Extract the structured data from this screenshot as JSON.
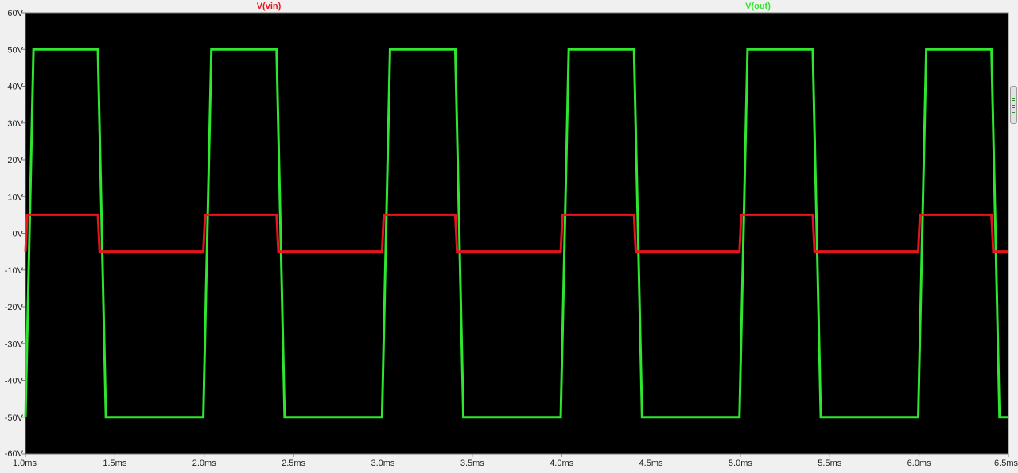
{
  "chart_data": {
    "type": "line",
    "title": "",
    "xlabel": "",
    "ylabel": "",
    "x_unit": "ms",
    "y_unit": "V",
    "xlim": [
      1.0,
      6.5
    ],
    "ylim": [
      -60,
      60
    ],
    "x_ticks": [
      1.0,
      1.5,
      2.0,
      2.5,
      3.0,
      3.5,
      4.0,
      4.5,
      5.0,
      5.5,
      6.0,
      6.5
    ],
    "x_tick_labels": [
      "1.0ms",
      "1.5ms",
      "2.0ms",
      "2.5ms",
      "3.0ms",
      "3.5ms",
      "4.0ms",
      "4.5ms",
      "5.0ms",
      "5.5ms",
      "6.0ms",
      "6.5ms"
    ],
    "y_ticks": [
      60,
      50,
      40,
      30,
      20,
      10,
      0,
      -10,
      -20,
      -30,
      -40,
      -50,
      -60
    ],
    "y_tick_labels": [
      "60V",
      "50V",
      "40V",
      "30V",
      "20V",
      "10V",
      "0V",
      "-10V",
      "-20V",
      "-30V",
      "-40V",
      "-50V",
      "-60V"
    ],
    "grid": false,
    "legend": "top",
    "background": "#000000",
    "series": [
      {
        "name": "V(vin)",
        "color": "#e8141c",
        "x": [
          1.0,
          1.01,
          1.405,
          1.415,
          1.995,
          2.005,
          2.405,
          2.415,
          2.995,
          3.005,
          3.405,
          3.415,
          3.995,
          4.005,
          4.405,
          4.415,
          4.995,
          5.005,
          5.405,
          5.415,
          5.995,
          6.005,
          6.405,
          6.415,
          6.5
        ],
        "y": [
          -5,
          5,
          5,
          -5,
          -5,
          5,
          5,
          -5,
          -5,
          5,
          5,
          -5,
          -5,
          5,
          5,
          -5,
          -5,
          5,
          5,
          -5,
          -5,
          5,
          5,
          -5,
          -5
        ]
      },
      {
        "name": "V(out)",
        "color": "#2ee62e",
        "x": [
          1.0,
          1.045,
          1.405,
          1.45,
          1.995,
          2.04,
          2.405,
          2.45,
          2.995,
          3.04,
          3.405,
          3.45,
          3.995,
          4.04,
          4.405,
          4.45,
          4.995,
          5.04,
          5.405,
          5.45,
          5.995,
          6.04,
          6.405,
          6.45,
          6.5
        ],
        "y": [
          -50,
          50,
          50,
          -50,
          -50,
          50,
          50,
          -50,
          -50,
          50,
          50,
          -50,
          -50,
          50,
          50,
          -50,
          -50,
          50,
          50,
          -50,
          -50,
          50,
          50,
          -50,
          -50
        ]
      }
    ]
  }
}
